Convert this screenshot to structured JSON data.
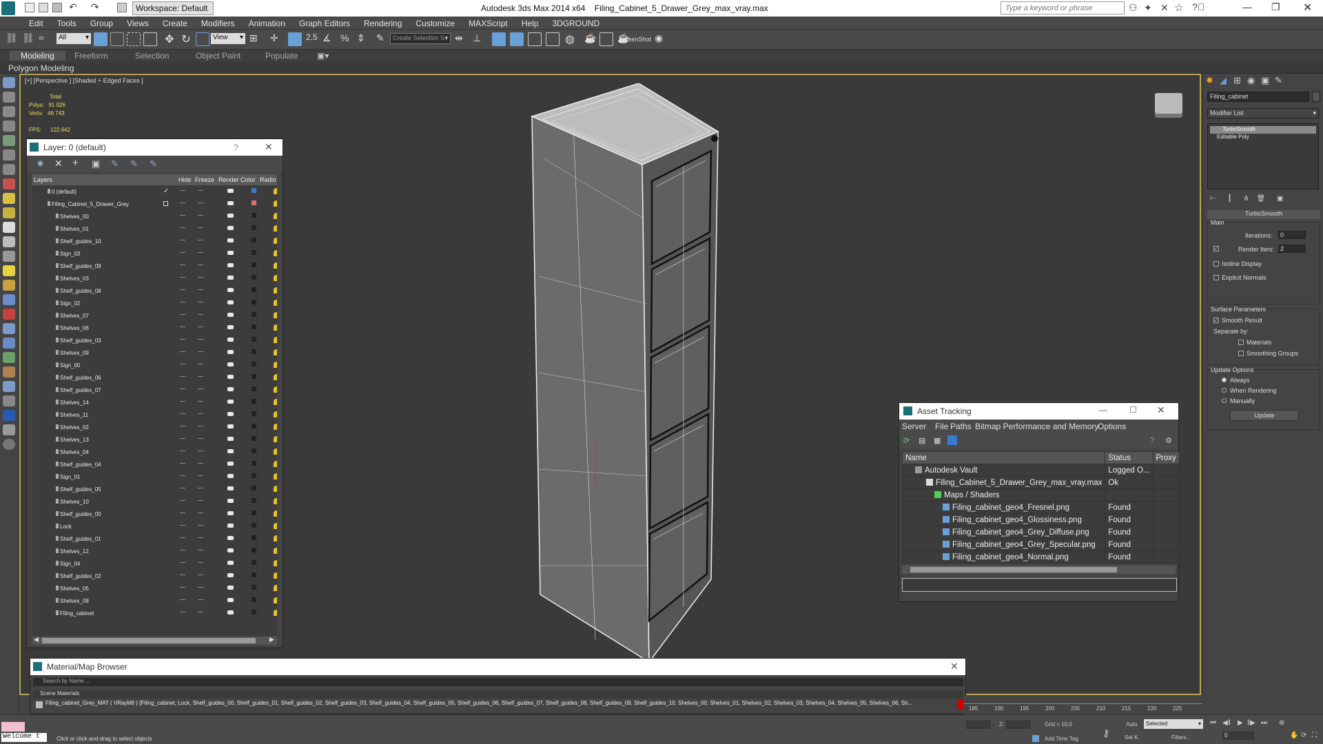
{
  "app": {
    "title": "Autodesk 3ds Max  2014 x64",
    "file": "Filing_Cabinet_5_Drawer_Grey_max_vray.max",
    "workspace": "Workspace: Default",
    "search_placeholder": "Type a keyword or phrase"
  },
  "menu": [
    "Edit",
    "Tools",
    "Group",
    "Views",
    "Create",
    "Modifiers",
    "Animation",
    "Graph Editors",
    "Rendering",
    "Customize",
    "MAXScript",
    "Help",
    "3DGROUND"
  ],
  "toolbar": {
    "filter": "All",
    "refcoord": "View",
    "selection_set": "Create Selection S",
    "screenshot_label": "ScreenShot"
  },
  "ribbon": {
    "tabs": [
      "Modeling",
      "Freeform",
      "Selection",
      "Object Paint",
      "Populate"
    ],
    "sub": "Polygon Modeling"
  },
  "viewport": {
    "label": "[+] [Perspective ] [Shaded + Edged Faces ]",
    "stats": {
      "total_label": "Total",
      "polys_label": "Polys:",
      "polys": "91 026",
      "verts_label": "Verts:",
      "verts": "46 743",
      "fps_label": "FPS:",
      "fps": "122,642"
    }
  },
  "layer": {
    "title": "Layer: 0 (default)",
    "help": "?",
    "cols": {
      "layers": "Layers",
      "hide": "Hide",
      "freeze": "Freeze",
      "render": "Render",
      "color": "Color",
      "radio": "Radio"
    },
    "rows": [
      {
        "name": "0 (default)",
        "check": "✓",
        "color": "#3a7ad0"
      },
      {
        "name": "Filing_Cabinet_5_Drawer_Grey",
        "color": "#e07070"
      },
      {
        "name": "Shelves_00"
      },
      {
        "name": "Shelves_01"
      },
      {
        "name": "Shelf_guides_10"
      },
      {
        "name": "Sign_03"
      },
      {
        "name": "Shelf_guides_09"
      },
      {
        "name": "Shelves_03"
      },
      {
        "name": "Shelf_guides_08"
      },
      {
        "name": "Sign_02"
      },
      {
        "name": "Shelves_07"
      },
      {
        "name": "Shelves_06"
      },
      {
        "name": "Shelf_guides_03"
      },
      {
        "name": "Shelves_09"
      },
      {
        "name": "Sign_00"
      },
      {
        "name": "Shelf_guides_06"
      },
      {
        "name": "Shelf_guides_07"
      },
      {
        "name": "Shelves_14"
      },
      {
        "name": "Shelves_11"
      },
      {
        "name": "Shelves_02"
      },
      {
        "name": "Shelves_13"
      },
      {
        "name": "Shelves_04"
      },
      {
        "name": "Shelf_guides_04"
      },
      {
        "name": "Sign_01"
      },
      {
        "name": "Shelf_guides_05"
      },
      {
        "name": "Shelves_10"
      },
      {
        "name": "Shelf_guides_00"
      },
      {
        "name": "Lock"
      },
      {
        "name": "Shelf_guides_01"
      },
      {
        "name": "Shelves_12"
      },
      {
        "name": "Sign_04"
      },
      {
        "name": "Shelf_guides_02"
      },
      {
        "name": "Shelves_05"
      },
      {
        "name": "Shelves_08"
      },
      {
        "name": "Filing_cabinet"
      }
    ]
  },
  "asset": {
    "title": "Asset Tracking",
    "menu": [
      "Server",
      "File",
      "Paths",
      "Bitmap Performance and Memory",
      "Options"
    ],
    "cols": [
      "Name",
      "Status",
      "Proxy"
    ],
    "rows": [
      {
        "name": "Autodesk Vault",
        "status": "Logged O..."
      },
      {
        "name": "Filing_Cabinet_5_Drawer_Grey_max_vray.max",
        "status": "Ok"
      },
      {
        "name": "Maps / Shaders",
        "status": ""
      },
      {
        "name": "Filing_cabinet_geo4_Fresnel.png",
        "status": "Found"
      },
      {
        "name": "Filing_cabinet_geo4_Glossiness.png",
        "status": "Found"
      },
      {
        "name": "Filing_cabinet_geo4_Grey_Diffuse.png",
        "status": "Found"
      },
      {
        "name": "Filing_cabinet_geo4_Grey_Specular.png",
        "status": "Found"
      },
      {
        "name": "Filing_cabinet_geo4_Normal.png",
        "status": "Found"
      }
    ]
  },
  "cmd": {
    "object_name": "Filing_cabinet",
    "modifier_list": "Modifier List",
    "stack": [
      "TurboSmooth",
      "Editable Poly"
    ],
    "rollout": "TurboSmooth",
    "main": "Main",
    "iterations_label": "Iterations:",
    "iterations": "0",
    "render_iters_label": "Render Iters:",
    "render_iters": "2",
    "isoline": "Isoline Display",
    "explicit": "Explicit Normals",
    "surface": "Surface Parameters",
    "smooth_result": "Smooth Result",
    "separate": "Separate by:",
    "materials": "Materials",
    "smoothing_groups": "Smoothing Groups",
    "update_options": "Update Options",
    "always": "Always",
    "when_rendering": "When Rendering",
    "manually": "Manually",
    "update_btn": "Update"
  },
  "matbrowser": {
    "title": "Material/Map Browser",
    "search": "Search by Name ...",
    "section": "Scene Materials",
    "entry": "Filing_cabinet_Grey_MAT ( VRayMtl ) [Filing_cabinet, Lock, Shelf_guides_00, Shelf_guides_01, Shelf_guides_02, Shelf_guides_03, Shelf_guides_04, Shelf_guides_05, Shelf_guides_06, Shelf_guides_07, Shelf_guides_08, Shelf_guides_09, Shelf_guides_10, Shelves_00, Shelves_01, Shelves_02, Shelves_03, Shelves_04, Shelves_05, Shelves_06, Sh..."
  },
  "timeline": {
    "ticks": [
      "185",
      "190",
      "195",
      "200",
      "205",
      "210",
      "215",
      "220",
      "225"
    ]
  },
  "status": {
    "welcome": "Welcome t",
    "prompt": "Click or click-and-drag to select objects",
    "z_label": "Z:",
    "grid": "Grid = 10,0",
    "add_time_tag": "Add Time Tag",
    "auto": "Auto",
    "selected": "Selected",
    "setk": "Set K.",
    "filters": "Filters...",
    "frame": "0"
  }
}
